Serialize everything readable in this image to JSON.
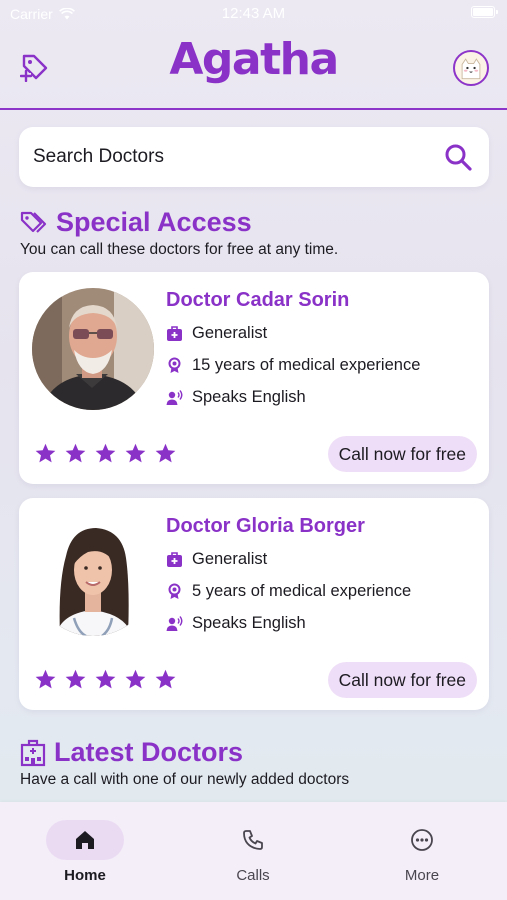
{
  "status_bar": {
    "carrier": "Carrier",
    "time": "12:43 AM"
  },
  "header": {
    "logo": "Agatha",
    "left_icon": "tag-add-icon",
    "right_icon": "avatar"
  },
  "search": {
    "placeholder": "Search Doctors"
  },
  "special_access": {
    "title": "Special Access",
    "subtitle": "You can call these doctors for free at any time.",
    "doctors": [
      {
        "name": "Doctor Cadar Sorin",
        "specialty": "Generalist",
        "experience": "15 years of medical experience",
        "language": "Speaks English",
        "rating": 5,
        "action": "Call now for free"
      },
      {
        "name": "Doctor Gloria Borger",
        "specialty": "Generalist",
        "experience": "5 years of medical experience",
        "language": "Speaks English",
        "rating": 5,
        "action": "Call now for free"
      }
    ]
  },
  "latest": {
    "title": "Latest Doctors",
    "subtitle": "Have a call with one of our newly added doctors"
  },
  "bottom_nav": {
    "items": [
      {
        "label": "Home",
        "icon": "home-icon",
        "active": true
      },
      {
        "label": "Calls",
        "icon": "phone-icon",
        "active": false
      },
      {
        "label": "More",
        "icon": "more-icon",
        "active": false
      }
    ]
  },
  "colors": {
    "accent": "#8a32c8",
    "pill": "#efdef7",
    "nav_active": "#eadbf3"
  }
}
